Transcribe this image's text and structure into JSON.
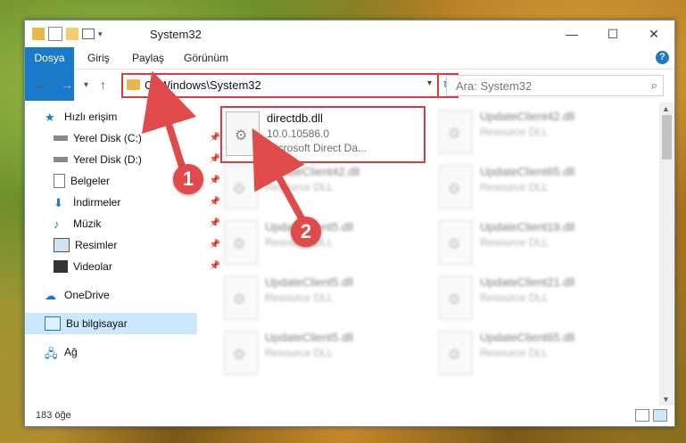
{
  "window": {
    "title": "System32",
    "controls": {
      "minimize": "—",
      "maximize": "☐",
      "close": "✕"
    }
  },
  "ribbon": {
    "tabs": [
      "Dosya",
      "Giriş",
      "Paylaş",
      "Görünüm"
    ],
    "help": "?"
  },
  "address": {
    "path": "C:\\Windows\\System32",
    "search_placeholder": "Ara: System32"
  },
  "sidebar": {
    "items": [
      {
        "label": "Hızlı erişim",
        "icon": "star-icon"
      },
      {
        "label": "Yerel Disk (C:)",
        "icon": "drive-icon",
        "pinned": true
      },
      {
        "label": "Yerel Disk (D:)",
        "icon": "drive-icon",
        "pinned": true
      },
      {
        "label": "Belgeler",
        "icon": "documents-icon",
        "pinned": true
      },
      {
        "label": "İndirmeler",
        "icon": "download-icon",
        "pinned": true
      },
      {
        "label": "Müzik",
        "icon": "music-icon",
        "pinned": true
      },
      {
        "label": "Resimler",
        "icon": "pictures-icon",
        "pinned": true
      },
      {
        "label": "Videolar",
        "icon": "videos-icon",
        "pinned": true
      },
      {
        "label": "OneDrive",
        "icon": "cloud-icon"
      },
      {
        "label": "Bu bilgisayar",
        "icon": "computer-icon",
        "selected": true
      },
      {
        "label": "Ağ",
        "icon": "network-icon"
      }
    ]
  },
  "files": {
    "main": {
      "name": "directdb.dll",
      "version": "10.0.10586.0",
      "description": "Microsoft Direct Da..."
    },
    "others": [
      {
        "name": "UpdateClient42.dll",
        "sub": "Resource DLL"
      },
      {
        "name": "UpdateClient42.dll",
        "sub": "Resource DLL"
      },
      {
        "name": "UpdateClient65.dll",
        "sub": "Resource DLL"
      },
      {
        "name": "UpdateClient5.dll",
        "sub": "Resource DLL"
      },
      {
        "name": "UpdateClient19.dll",
        "sub": "Resource DLL"
      },
      {
        "name": "UpdateClient5.dll",
        "sub": "Resource DLL"
      },
      {
        "name": "UpdateClient21.dll",
        "sub": "Resource DLL"
      },
      {
        "name": "UpdateClient5.dll",
        "sub": "Resource DLL"
      },
      {
        "name": "UpdateClient65.dll",
        "sub": "Resource DLL"
      }
    ]
  },
  "status": {
    "count": "183 öğe"
  },
  "callouts": [
    "1",
    "2"
  ],
  "colors": {
    "accent": "#1979ca",
    "highlight": "#d83c3c",
    "selected": "#cce8ff"
  }
}
